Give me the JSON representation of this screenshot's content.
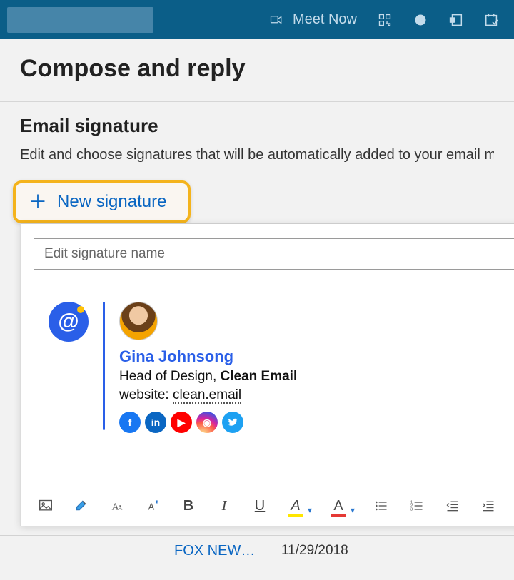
{
  "topbar": {
    "meet_now_label": "Meet Now"
  },
  "page": {
    "title": "Compose and reply"
  },
  "signature_section": {
    "heading": "Email signature",
    "description": "Edit and choose signatures that will be automatically added to your email message",
    "new_signature_label": "New signature",
    "name_placeholder": "Edit signature name"
  },
  "signature_preview": {
    "name": "Gina Johnsong",
    "role": "Head of Design, ",
    "company": "Clean Email",
    "website_label": "website: ",
    "website_url": "clean.email",
    "social": [
      "facebook",
      "linkedin",
      "youtube",
      "instagram",
      "twitter"
    ]
  },
  "toolbar_labels": {
    "bold": "B",
    "italic": "I",
    "underline": "U",
    "highlight": "A",
    "fontcolor": "A"
  },
  "background_row": {
    "title": "FOX NEWS BREAKING",
    "date": "11/29/2018"
  }
}
